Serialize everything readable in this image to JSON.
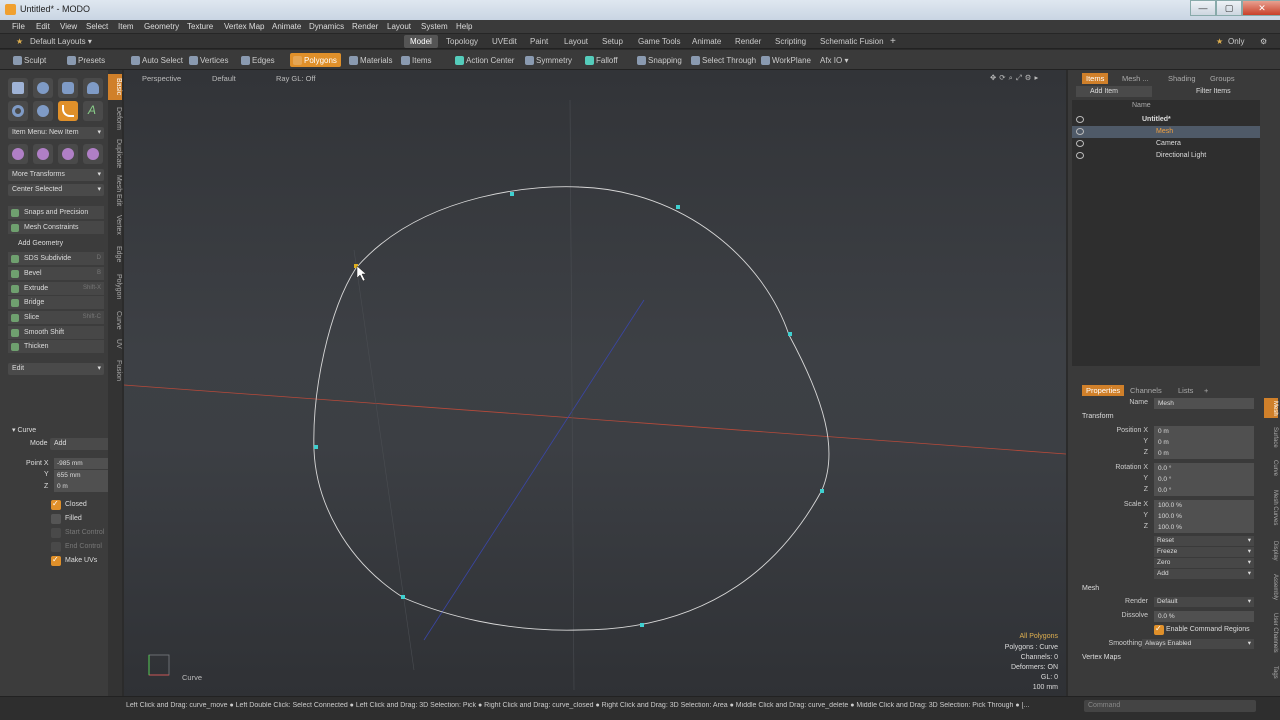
{
  "window": {
    "title": "Untitled* - MODO",
    "minimize": "—",
    "maximize": "▢",
    "close": "✕"
  },
  "menu": [
    "File",
    "Edit",
    "View",
    "Select",
    "Item",
    "Geometry",
    "Texture",
    "Vertex Map",
    "Animate",
    "Dynamics",
    "Render",
    "Layout",
    "System",
    "Help"
  ],
  "layoutbar": {
    "default_layouts": "Default Layouts ▾",
    "tabs": [
      "Model",
      "Topology",
      "UVEdit",
      "Paint",
      "Layout",
      "Setup",
      "Game Tools",
      "Animate",
      "Render",
      "Scripting",
      "Schematic Fusion"
    ],
    "active_tab": "Model",
    "add": "+",
    "only": "Only"
  },
  "toolbar": {
    "sculpt": "Sculpt",
    "presets": "Presets",
    "items": [
      "Auto Select",
      "Vertices",
      "Edges",
      "Polygons",
      "Materials",
      "Items",
      "Action Center",
      "Symmetry",
      "Falloff",
      "Snapping",
      "Select Through",
      "WorkPlane",
      "Afx IO ▾"
    ],
    "active": "Polygons"
  },
  "left_tabs": [
    "Basic",
    "Deform",
    "Duplicate",
    "Mesh Edit",
    "Vertex",
    "Edge",
    "Polygon",
    "Curve",
    "UV",
    "Fusion"
  ],
  "left": {
    "item_menu": "Item Menu: New Item",
    "more_transforms": "More Transforms",
    "center_selected": "Center Selected",
    "snaps": "Snaps and Precision",
    "mesh_constraints": "Mesh Constraints",
    "add_geometry": "Add Geometry",
    "tools": [
      {
        "label": "SDS Subdivide",
        "shortcut": "D"
      },
      {
        "label": "Bevel",
        "shortcut": "B"
      },
      {
        "label": "Extrude",
        "shortcut": "Shift-X"
      },
      {
        "label": "Bridge",
        "shortcut": ""
      },
      {
        "label": "Slice",
        "shortcut": "Shift-C"
      },
      {
        "label": "Smooth Shift",
        "shortcut": ""
      },
      {
        "label": "Thicken",
        "shortcut": ""
      }
    ],
    "edit": "Edit",
    "curve": {
      "header": "Curve",
      "mode_label": "Mode",
      "mode_value": "Add",
      "point_x_label": "Point X",
      "point_x": "-985 mm",
      "y_label": "Y",
      "y": "655 mm",
      "z_label": "Z",
      "z": "0 m",
      "closed": "Closed",
      "filled": "Filled",
      "start_control": "Start Control",
      "end_control": "End Control",
      "make_uvs": "Make UVs"
    }
  },
  "viewport": {
    "header": [
      "Perspective",
      "Default",
      "Ray GL: Off"
    ],
    "gizmo_label": "Curve",
    "info": [
      "All Polygons",
      "Polygons : Curve",
      "Channels: 0",
      "Deformers: ON",
      "GL: 0",
      "100 mm"
    ]
  },
  "right": {
    "tabs": [
      "Items",
      "Mesh ...",
      "Shading",
      "Groups"
    ],
    "add_item": "Add Item",
    "filter_items": "Filter Items",
    "col_name": "Name",
    "tree": [
      "Untitled*",
      "Mesh",
      "Camera",
      "Directional Light"
    ],
    "props_tabs": [
      "Properties",
      "Channels",
      "Lists",
      "+"
    ],
    "name_label": "Name",
    "name_value": "Mesh",
    "transform": "Transform",
    "position_x": "Position X",
    "rotation_x": "Rotation X",
    "scale_x": "Scale X",
    "axis_y": "Y",
    "axis_z": "Z",
    "pos": [
      "0 m",
      "0 m",
      "0 m"
    ],
    "rot": [
      "0.0 °",
      "0.0 °",
      "0.0 °"
    ],
    "scale": [
      "100.0 %",
      "100.0 %",
      "100.0 %"
    ],
    "actions": [
      "Reset",
      "Freeze",
      "Zero",
      "Add"
    ],
    "mesh": "Mesh",
    "render_label": "Render",
    "render_value": "Default",
    "dissolve_label": "Dissolve",
    "dissolve_value": "0.0 %",
    "enable_cmd": "Enable Command Regions",
    "smoothing_label": "Smoothing",
    "smoothing_value": "Always Enabled",
    "vertex_maps": "Vertex Maps",
    "side_tabs": [
      "Mesh",
      "Surface",
      "Curve",
      "Mesh Curves",
      "Display",
      "Assembly",
      "User Channels",
      "Tags"
    ]
  },
  "status": {
    "text": "Left Click and Drag: curve_move ● Left Double Click: Select Connected ● Left Click and Drag: 3D Selection: Pick ● Right Click and Drag: curve_closed ● Right Click and Drag: 3D Selection: Area ● Middle Click and Drag: curve_delete ● Middle Click and Drag: 3D Selection: Pick Through ● [...",
    "command_placeholder": "Command"
  }
}
